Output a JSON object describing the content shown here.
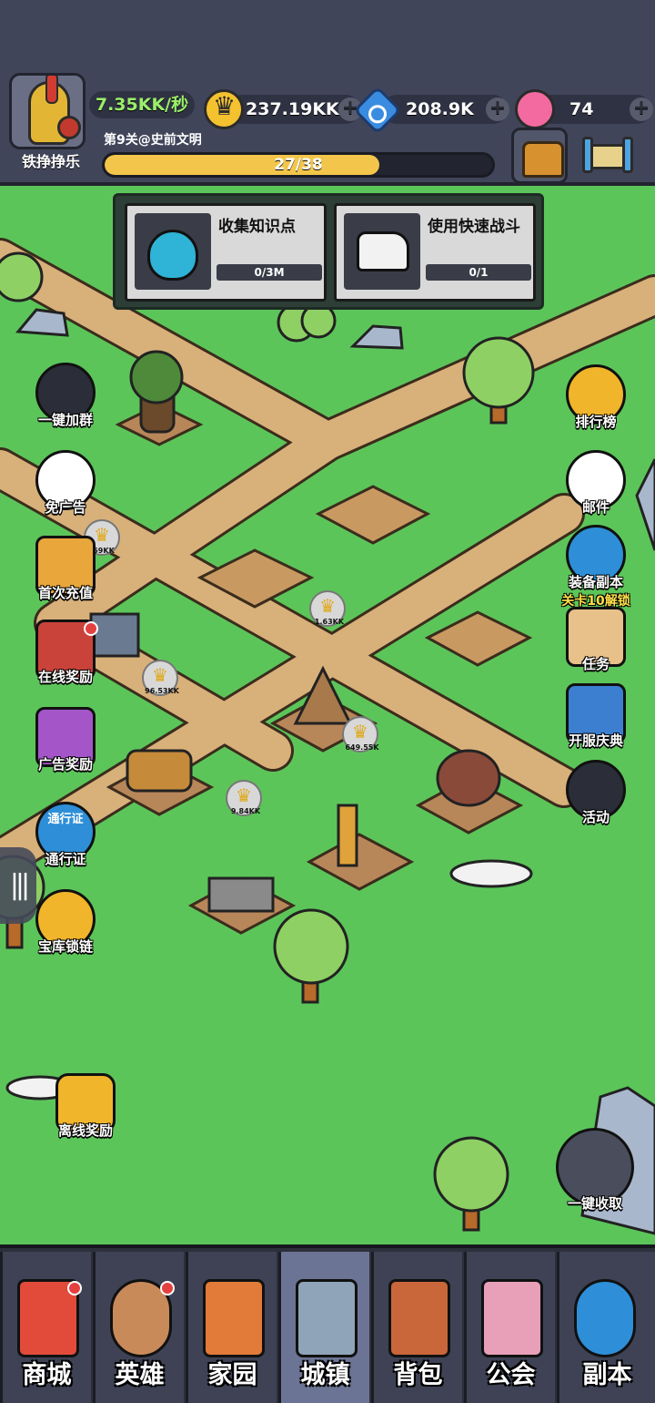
{
  "player": {
    "name": "铁挣挣乐"
  },
  "income": "7.35KK/秒",
  "resources": [
    {
      "name": "crown",
      "value": "237.19KK"
    },
    {
      "name": "gem",
      "value": "208.9K"
    },
    {
      "name": "candy",
      "value": "74"
    }
  ],
  "level": {
    "label": "第9关@史前文明",
    "progress_text": "27/38",
    "progress_fraction": 0.71
  },
  "quests": [
    {
      "title": "收集知识点",
      "progress": "0/3M"
    },
    {
      "title": "使用快速战斗",
      "progress": "0/1"
    }
  ],
  "left_buttons": [
    {
      "label": "一键加群",
      "icon": "qq-penguin-icon"
    },
    {
      "label": "免广告",
      "icon": "no-ads-icon"
    },
    {
      "label": "首次充值",
      "icon": "first-recharge-chest-icon"
    },
    {
      "label": "在线奖励",
      "icon": "online-reward-chest-icon"
    },
    {
      "label": "广告奖励",
      "icon": "ad-reward-chest-icon"
    },
    {
      "label": "通行证",
      "icon": "pass-icon",
      "icon_text": "通行证"
    },
    {
      "label": "宝库锁链",
      "icon": "chain-icon"
    },
    {
      "label": "离线奖励",
      "icon": "offline-reward-icon"
    }
  ],
  "right_buttons": [
    {
      "label": "排行榜",
      "icon": "trophy-icon"
    },
    {
      "label": "邮件",
      "icon": "mail-icon"
    },
    {
      "label": "装备副本",
      "sub": "关卡10解锁",
      "icon": "globe-icon"
    },
    {
      "label": "任务",
      "icon": "task-clipboard-icon"
    },
    {
      "label": "开服庆典",
      "icon": "map-scroll-icon"
    },
    {
      "label": "活动",
      "icon": "party-hat-icon"
    },
    {
      "label": "一键收取",
      "icon": "collect-crowns-icon"
    }
  ],
  "map_markers": [
    "59KK",
    "1.63KK",
    "96.53KK",
    "649.55K",
    "9.84KK"
  ],
  "nav": [
    {
      "label": "商城",
      "badge": true
    },
    {
      "label": "英雄",
      "badge": true
    },
    {
      "label": "家园",
      "badge": false
    },
    {
      "label": "城镇",
      "badge": false,
      "active": true
    },
    {
      "label": "背包",
      "badge": false
    },
    {
      "label": "公会",
      "badge": false
    },
    {
      "label": "副本",
      "badge": false
    }
  ],
  "colors": {
    "grass": "#5cc55a",
    "path": "#d8b07a",
    "hud": "#41455a",
    "gold": "#f3c64b",
    "income_green": "#9bef6a"
  }
}
